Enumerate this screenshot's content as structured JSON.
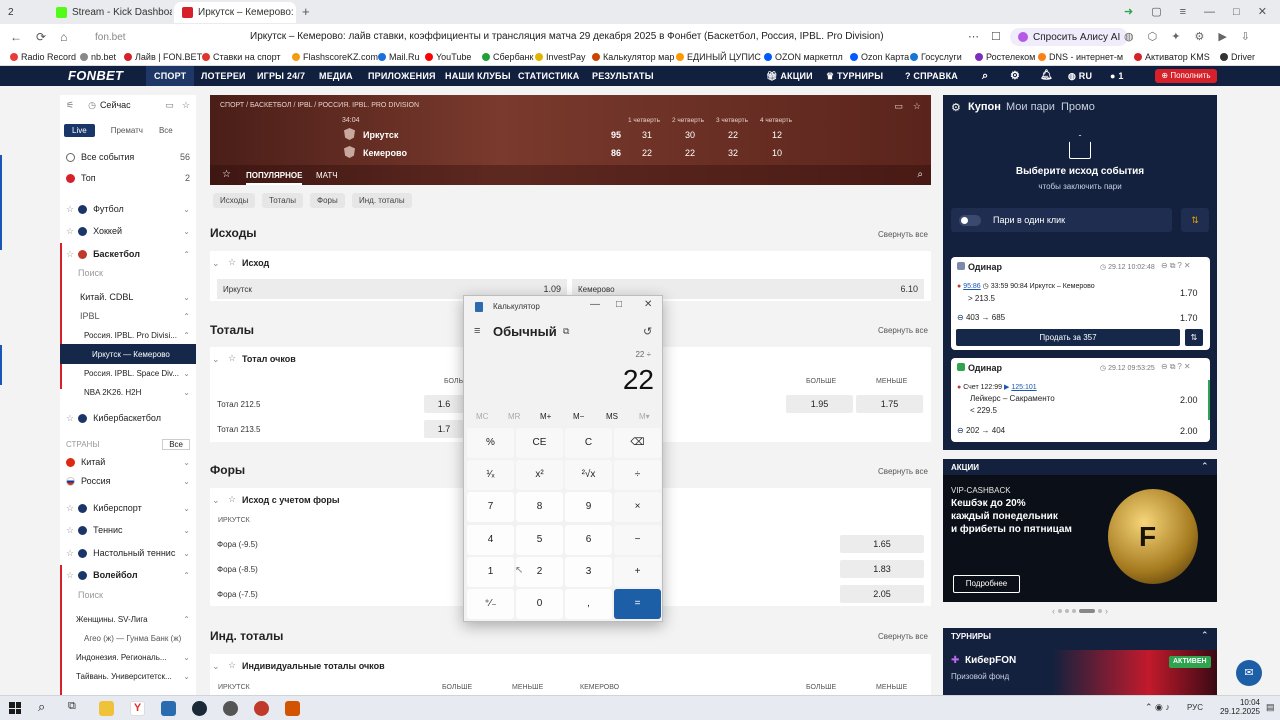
{
  "browser": {
    "tab_count": "2",
    "tabs": [
      {
        "title": "Stream - Kick Dashboard"
      },
      {
        "title": "Иркутск – Кемерово: л"
      }
    ],
    "url": "fon.bet",
    "page_title": "Иркутск – Кемерово: лайв ставки, коэффициенты и трансляция матча 29 декабря 2025 в Фонбет (Баскетбол, Россия, IPBL. Pro Division)",
    "alice_label": "Спросить Алису AI",
    "bookmarks": [
      "Radio Record",
      "nb.bet",
      "Лайв | FON.BET",
      "Ставки на спорт",
      "FlashscoreKZ.com",
      "Mail.Ru",
      "YouTube",
      "Сбербанк",
      "InvestPay",
      "Калькулятор мар",
      "ЕДИНЫЙ ЦУПИС",
      "OZON маркетпл",
      "Ozon Карта",
      "Госуслуги",
      "Ростелеком",
      "DNS - интернет-м",
      "Активатор KMS",
      "Driver"
    ]
  },
  "site": {
    "logo": "FONBET",
    "nav": [
      "СПОРТ",
      "ЛОТЕРЕИ",
      "ИГРЫ 24/7",
      "МЕДИА",
      "ПРИЛОЖЕНИЯ",
      "НАШИ КЛУБЫ",
      "СТАТИСТИКА",
      "РЕЗУЛЬТАТЫ"
    ],
    "nav_right": [
      "АКЦИИ",
      "ТУРНИРЫ",
      "СПРАВКА"
    ],
    "lang": "RU",
    "user_count": "1",
    "deposit": "Пополнить",
    "accent": "#d6212a",
    "navy": "#122040"
  },
  "sidebar": {
    "now_label": "Сейчас",
    "modes": [
      "Live",
      "Прематч",
      "Все"
    ],
    "all_events": {
      "label": "Все события",
      "count": "56"
    },
    "top": {
      "label": "Топ",
      "count": "2"
    },
    "sports": [
      "Футбол",
      "Хоккей",
      "Баскетбол"
    ],
    "search": "Поиск",
    "leagues": [
      "Китай. CDBL",
      "IPBL",
      "Россия. IPBL. Pro Divisi...",
      "Иркутск — Кемерово",
      "Россия. IPBL. Space Div...",
      "NBA 2K26. H2H",
      "Кибербаскетбол"
    ],
    "countries_label": "СТРАНЫ",
    "countries_select": "Все",
    "countries": [
      "Китай",
      "Россия"
    ],
    "more_sports": [
      "Киберспорт",
      "Теннис",
      "Настольный теннис",
      "Волейбол"
    ],
    "volley_search": "Поиск",
    "volley": [
      "Женщины. SV-Лига",
      "Агео (ж) — Гунма Банк (ж)",
      "Индонезия. Региональ...",
      "Тайвань. Университетск..."
    ]
  },
  "scoreboard": {
    "breadcrumb": "СПОРТ / БАСКЕТБОЛ / IPBL / РОССИЯ. IPBL. PRO DIVISION",
    "time": "34:04",
    "quarters": [
      "1 четверть",
      "2 четверть",
      "3 четверть",
      "4 четверть"
    ],
    "teams": [
      {
        "name": "Иркутск",
        "total": "95",
        "q": [
          "31",
          "30",
          "22",
          "12"
        ]
      },
      {
        "name": "Кемерово",
        "total": "86",
        "q": [
          "22",
          "22",
          "32",
          "10"
        ]
      }
    ],
    "tabs": [
      "ПОПУЛЯРНОЕ",
      "МАТЧ"
    ]
  },
  "filters": [
    "Исходы",
    "Тоталы",
    "Форы",
    "Инд. тоталы"
  ],
  "collapse_label": "Свернуть все",
  "outcomes": {
    "title": "Исходы",
    "sub": "Исход",
    "left_team": "Иркутск",
    "left_odd": "1.09",
    "right_team": "Кемерово",
    "right_odd": "6.10"
  },
  "totals": {
    "title": "Тоталы",
    "sub": "Тотал очков",
    "over": "БОЛЬШЕ",
    "under": "МЕНЬШЕ",
    "rows": [
      {
        "label": "Тотал 212.5",
        "left_odd": "1.6",
        "right_over": "1.95",
        "right_under": "1.75"
      },
      {
        "label": "Тотал 213.5",
        "left_odd": "1.7"
      }
    ]
  },
  "handicaps": {
    "title": "Форы",
    "sub": "Исход с учетом форы",
    "team": "ИРКУТСК",
    "rows": [
      {
        "label": "Фора (-9.5)",
        "odd": "1.65"
      },
      {
        "label": "Фора (-8.5)",
        "odd": "1.83"
      },
      {
        "label": "Фора (-7.5)",
        "odd": "2.05"
      }
    ]
  },
  "ind_totals": {
    "title": "Инд. тоталы",
    "sub": "Индивидуальные тоталы очков",
    "left_team": "ИРКУТСК",
    "right_team": "КЕМЕРОВО",
    "over": "БОЛЬШЕ",
    "under": "МЕНЬШЕ"
  },
  "calculator": {
    "title": "Калькулятор",
    "mode": "Обычный",
    "expression": "22 ÷",
    "display": "22",
    "memory": [
      "MC",
      "MR",
      "M+",
      "M−",
      "MS",
      "M▾"
    ],
    "keys": [
      [
        "%",
        "CE",
        "C",
        "⌫"
      ],
      [
        "¹⁄ₓ",
        "x²",
        "²√x",
        "÷"
      ],
      [
        "7",
        "8",
        "9",
        "×"
      ],
      [
        "4",
        "5",
        "6",
        "−"
      ],
      [
        "1",
        "2",
        "3",
        "+"
      ],
      [
        "⁺⁄₋",
        "0",
        ",",
        "="
      ]
    ]
  },
  "coupon": {
    "tabs": [
      "Купон",
      "Мои пари",
      "Промо"
    ],
    "prompt": "Выберите исход события",
    "prompt_sub": "чтобы заключить пари",
    "oneclick": "Пари в один клик",
    "bets": [
      {
        "type": "Одинар",
        "date": "29.12",
        "time": "10:02:48",
        "live": "95:86",
        "event_time": "33:59",
        "event": "90:84 Иркутск – Кемерово",
        "selection": "> 213.5",
        "odd": "1.70",
        "stake": "403",
        "win": "685",
        "final_odd": "1.70",
        "sell": "Продать за 357"
      },
      {
        "type": "Одинар",
        "date": "29.12",
        "time": "09:53:25",
        "score_text": "Счет 122:99",
        "score_live": "125:101",
        "event": "Лейкерс – Сакраменто",
        "selection": "< 229.5",
        "odd": "2.00",
        "stake": "202",
        "win": "404",
        "final_odd": "2.00"
      }
    ]
  },
  "promo": {
    "header": "АКЦИИ",
    "kicker": "VIP-CASHBACK",
    "lines": [
      "Кешбэк до 20%",
      "каждый понедельник",
      "и фрибеты по пятницам"
    ],
    "button": "Подробнее"
  },
  "tournaments": {
    "header": "ТУРНИРЫ",
    "name": "КиберFON",
    "badge": "АКТИВЕН",
    "sub": "Призовой фонд"
  },
  "taskbar": {
    "time": "10:04",
    "date": "29.12.2025",
    "lang": "РУС"
  }
}
